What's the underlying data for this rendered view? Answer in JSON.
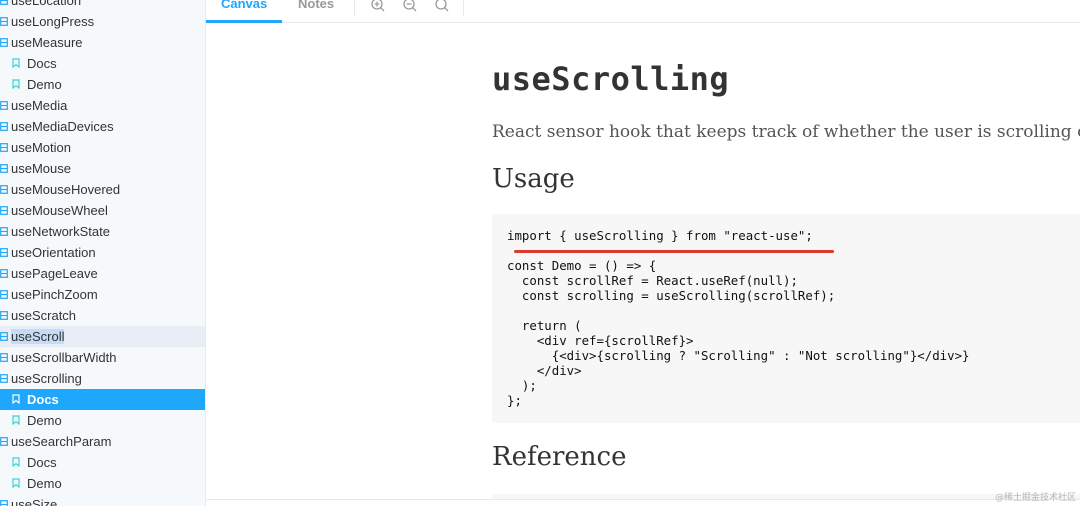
{
  "sidebar": {
    "items": [
      {
        "label": "useLocation",
        "kind": "component",
        "state": ""
      },
      {
        "label": "useLongPress",
        "kind": "component",
        "state": ""
      },
      {
        "label": "useMeasure",
        "kind": "component",
        "state": ""
      },
      {
        "label": "Docs",
        "kind": "story",
        "state": ""
      },
      {
        "label": "Demo",
        "kind": "story",
        "state": ""
      },
      {
        "label": "useMedia",
        "kind": "component",
        "state": ""
      },
      {
        "label": "useMediaDevices",
        "kind": "component",
        "state": ""
      },
      {
        "label": "useMotion",
        "kind": "component",
        "state": ""
      },
      {
        "label": "useMouse",
        "kind": "component",
        "state": ""
      },
      {
        "label": "useMouseHovered",
        "kind": "component",
        "state": ""
      },
      {
        "label": "useMouseWheel",
        "kind": "component",
        "state": ""
      },
      {
        "label": "useNetworkState",
        "kind": "component",
        "state": ""
      },
      {
        "label": "useOrientation",
        "kind": "component",
        "state": ""
      },
      {
        "label": "usePageLeave",
        "kind": "component",
        "state": ""
      },
      {
        "label": "usePinchZoom",
        "kind": "component",
        "state": ""
      },
      {
        "label": "useScratch",
        "kind": "component",
        "state": ""
      },
      {
        "label": "useScroll",
        "kind": "component",
        "state": "hover"
      },
      {
        "label": "useScrollbarWidth",
        "kind": "component",
        "state": ""
      },
      {
        "label": "useScrolling",
        "kind": "component",
        "state": ""
      },
      {
        "label": "Docs",
        "kind": "story",
        "state": "selected"
      },
      {
        "label": "Demo",
        "kind": "story",
        "state": ""
      },
      {
        "label": "useSearchParam",
        "kind": "component",
        "state": ""
      },
      {
        "label": "Docs",
        "kind": "story",
        "state": ""
      },
      {
        "label": "Demo",
        "kind": "story",
        "state": ""
      },
      {
        "label": "useSize",
        "kind": "component",
        "state": ""
      }
    ]
  },
  "toolbar": {
    "tabs": [
      {
        "label": "Canvas",
        "active": true
      },
      {
        "label": "Notes",
        "active": false
      }
    ],
    "icons": [
      "zoom-in-icon",
      "zoom-out-icon",
      "zoom-reset-icon"
    ]
  },
  "doc": {
    "title": "useScrolling",
    "description": "React sensor hook that keeps track of whether the user is scrolling or not.",
    "usage_heading": "Usage",
    "code": "import { useScrolling } from \"react-use\";\n\nconst Demo = () => {\n  const scrollRef = React.useRef(null);\n  const scrolling = useScrolling(scrollRef);\n\n  return (\n    <div ref={scrollRef}>\n      {<div>{scrolling ? \"Scrolling\" : \"Not scrolling\"}</div>}\n    </div>\n  );\n};",
    "reference_heading": "Reference"
  },
  "watermark": "@稀土掘金技术社区",
  "colors": {
    "accent": "#1ea7fd",
    "story_icon": "#37d5d3",
    "annotation_underline": "#e03a2f"
  }
}
